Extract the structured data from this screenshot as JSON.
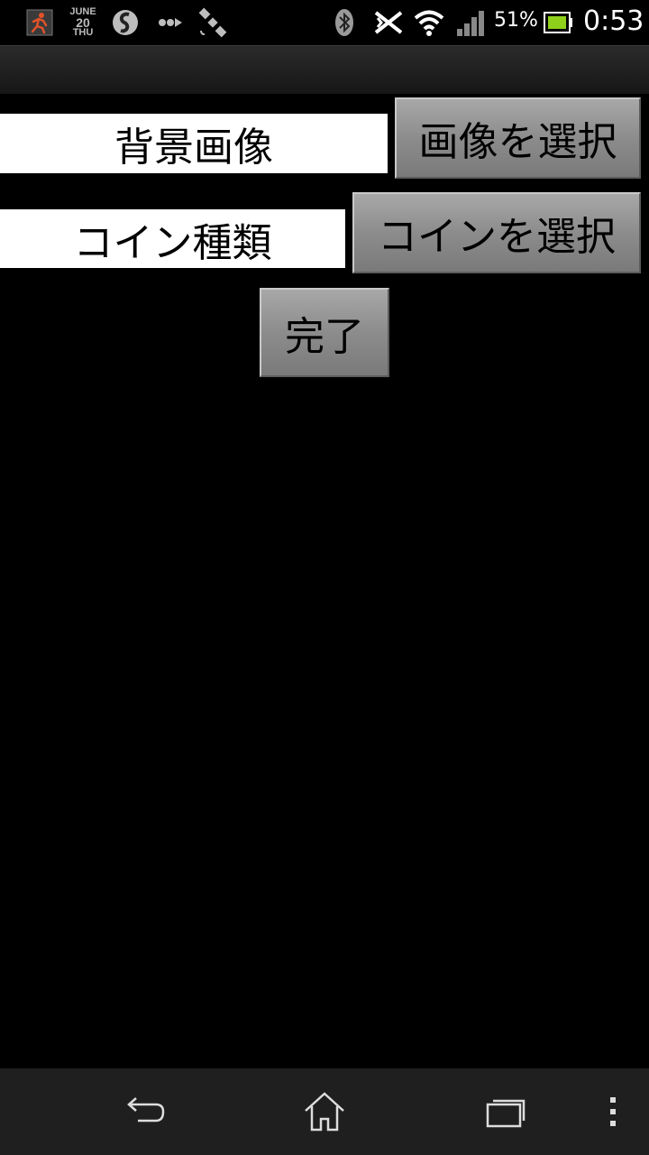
{
  "status_bar": {
    "date_month": "JUNE",
    "date_day": "20",
    "date_weekday": "THU",
    "battery_percent": "51%",
    "time": "0:53",
    "icons": [
      "running-app-icon",
      "calendar-date-icon",
      "sync-app-icon",
      "data-transfer-icon",
      "satellite-gps-icon",
      "bluetooth-icon",
      "nfc-icon",
      "wifi-icon",
      "signal-icon",
      "battery-icon"
    ],
    "colors": {
      "running_icon": "#e0532a",
      "battery_fill": "#8fd11a"
    }
  },
  "rows": {
    "background": {
      "label": "背景画像",
      "button": "画像を選択"
    },
    "coin": {
      "label": "コイン種類",
      "button": "コインを選択"
    }
  },
  "done_button": "完了",
  "nav_bar": {
    "icons": [
      "back-icon",
      "home-icon",
      "recent-apps-icon",
      "menu-icon"
    ]
  }
}
